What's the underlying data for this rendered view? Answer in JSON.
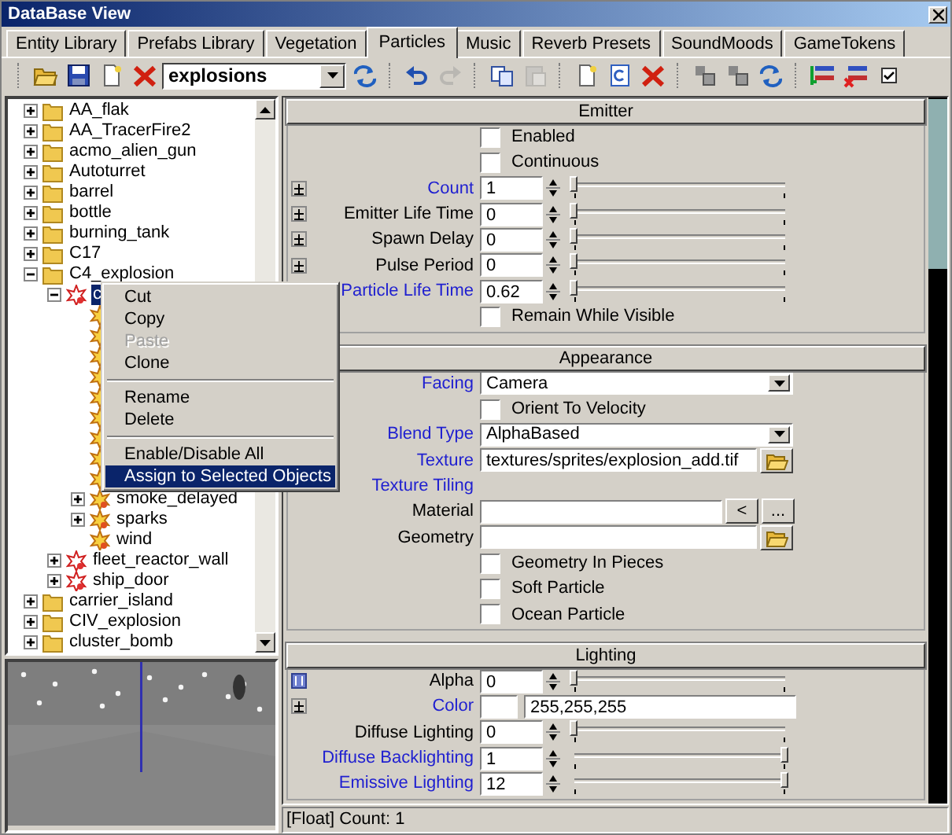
{
  "window": {
    "title": "DataBase View"
  },
  "tabs": [
    {
      "label": "Entity Library",
      "selected": false
    },
    {
      "label": "Prefabs Library",
      "selected": false
    },
    {
      "label": "Vegetation",
      "selected": false
    },
    {
      "label": "Particles",
      "selected": true
    },
    {
      "label": "Music",
      "selected": false
    },
    {
      "label": "Reverb Presets",
      "selected": false
    },
    {
      "label": "SoundMoods",
      "selected": false
    },
    {
      "label": "GameTokens",
      "selected": false
    }
  ],
  "toolbar": {
    "groups": [
      [
        {
          "kind": "open",
          "disabled": false
        },
        {
          "kind": "save",
          "disabled": false
        },
        {
          "kind": "new",
          "disabled": false
        },
        {
          "kind": "delete",
          "disabled": false
        },
        {
          "kind": "combo",
          "value": "explosions"
        },
        {
          "kind": "refresh",
          "disabled": false
        }
      ],
      [
        {
          "kind": "undo",
          "disabled": false
        },
        {
          "kind": "redo",
          "disabled": true
        }
      ],
      [
        {
          "kind": "copy",
          "disabled": false
        },
        {
          "kind": "paste",
          "disabled": true
        }
      ],
      [
        {
          "kind": "new",
          "disabled": false
        },
        {
          "kind": "clone",
          "disabled": false
        },
        {
          "kind": "delete",
          "disabled": false
        }
      ],
      [
        {
          "kind": "pick",
          "disabled": false
        },
        {
          "kind": "pick",
          "disabled": false
        },
        {
          "kind": "refresh",
          "disabled": false
        }
      ],
      [
        {
          "kind": "assign",
          "disabled": false
        },
        {
          "kind": "unassign",
          "disabled": false
        },
        {
          "kind": "check",
          "disabled": false
        }
      ]
    ]
  },
  "tree": [
    {
      "label": "AA_flak",
      "kind": "folder",
      "expandable": true,
      "expanded": false,
      "selected": false
    },
    {
      "label": "AA_TracerFire2",
      "kind": "folder",
      "expandable": true,
      "expanded": false,
      "selected": false
    },
    {
      "label": "acmo_alien_gun",
      "kind": "folder",
      "expandable": true,
      "expanded": false,
      "selected": false
    },
    {
      "label": "Autoturret",
      "kind": "folder",
      "expandable": true,
      "expanded": false,
      "selected": false
    },
    {
      "label": "barrel",
      "kind": "folder",
      "expandable": true,
      "expanded": false,
      "selected": false
    },
    {
      "label": "bottle",
      "kind": "folder",
      "expandable": true,
      "expanded": false,
      "selected": false
    },
    {
      "label": "burning_tank",
      "kind": "folder",
      "expandable": true,
      "expanded": false,
      "selected": false
    },
    {
      "label": "C17",
      "kind": "folder",
      "expandable": true,
      "expanded": false,
      "selected": false
    },
    {
      "label": "C4_explosion",
      "kind": "folder",
      "expandable": true,
      "expanded": true,
      "selected": false,
      "children": [
        {
          "label": "c",
          "kind": "group",
          "expandable": true,
          "expanded": true,
          "selected": true,
          "children": [
            {
              "kind": "effect"
            },
            {
              "kind": "effect"
            },
            {
              "kind": "effect"
            },
            {
              "kind": "effect"
            },
            {
              "kind": "effect"
            },
            {
              "kind": "effect"
            },
            {
              "kind": "effect"
            },
            {
              "kind": "effect"
            },
            {
              "kind": "effect"
            },
            {
              "label": "smoke_delayed",
              "kind": "effect",
              "expandable": true,
              "expanded": false,
              "selected": false
            },
            {
              "label": "sparks",
              "kind": "effect",
              "expandable": true,
              "expanded": false,
              "selected": false
            },
            {
              "label": "wind",
              "kind": "effect",
              "expandable": false,
              "selected": false
            }
          ]
        },
        {
          "label": "fleet_reactor_wall",
          "kind": "group",
          "expandable": true,
          "expanded": false,
          "selected": false
        },
        {
          "label": "ship_door",
          "kind": "group",
          "expandable": true,
          "expanded": false,
          "selected": false
        }
      ]
    },
    {
      "label": "carrier_island",
      "kind": "folder",
      "expandable": true,
      "expanded": false,
      "selected": false
    },
    {
      "label": "CIV_explosion",
      "kind": "folder",
      "expandable": true,
      "expanded": false,
      "selected": false
    },
    {
      "label": "cluster_bomb",
      "kind": "folder",
      "expandable": true,
      "expanded": false,
      "selected": false
    }
  ],
  "context_menu": [
    {
      "kind": "item",
      "label": "Cut",
      "disabled": false,
      "selected": false
    },
    {
      "kind": "item",
      "label": "Copy",
      "disabled": false,
      "selected": false
    },
    {
      "kind": "item",
      "label": "Paste",
      "disabled": true,
      "selected": false
    },
    {
      "kind": "item",
      "label": "Clone",
      "disabled": false,
      "selected": false
    },
    {
      "kind": "separator"
    },
    {
      "kind": "item",
      "label": "Rename",
      "disabled": false,
      "selected": false
    },
    {
      "kind": "item",
      "label": "Delete",
      "disabled": false,
      "selected": false
    },
    {
      "kind": "separator"
    },
    {
      "kind": "item",
      "label": "Enable/Disable All",
      "disabled": false,
      "selected": false
    },
    {
      "kind": "item",
      "label": "Assign to Selected Objects",
      "disabled": false,
      "selected": true
    }
  ],
  "sections": [
    {
      "title": "Emitter",
      "rows": [
        {
          "kind": "checkbox",
          "label": "Enabled",
          "checked": false
        },
        {
          "kind": "checkbox",
          "label": "Continuous",
          "checked": false
        },
        {
          "kind": "spin",
          "label": "Count",
          "value": "1",
          "level": 0,
          "highlighted": true,
          "expand_button": true,
          "pinned": false
        },
        {
          "kind": "spin",
          "label": "Emitter Life Time",
          "value": "0",
          "level": 0,
          "highlighted": false,
          "expand_button": true,
          "pinned": false
        },
        {
          "kind": "spin",
          "label": "Spawn Delay",
          "value": "0",
          "level": 0,
          "highlighted": false,
          "expand_button": true,
          "pinned": false
        },
        {
          "kind": "spin",
          "label": "Pulse Period",
          "value": "0",
          "level": 0,
          "highlighted": false,
          "expand_button": true,
          "pinned": false
        },
        {
          "kind": "spin",
          "label": "Particle Life Time",
          "value": "0.62",
          "level": 0,
          "highlighted": true
        },
        {
          "kind": "checkbox",
          "label": "Remain While Visible",
          "checked": false
        }
      ]
    },
    {
      "title": "Appearance",
      "rows": [
        {
          "kind": "dropdown",
          "label": "Facing",
          "value": "Camera",
          "highlighted": true
        },
        {
          "kind": "checkbox",
          "label": "Orient To Velocity",
          "checked": false
        },
        {
          "kind": "dropdown",
          "label": "Blend Type",
          "value": "AlphaBased",
          "highlighted": true
        },
        {
          "kind": "file",
          "label": "Texture",
          "value": "textures/sprites/explosion_add.tif",
          "highlighted": true
        },
        {
          "kind": "heading",
          "label": "Texture Tiling",
          "highlighted": true
        },
        {
          "kind": "material",
          "label": "Material",
          "highlighted": false,
          "pick": "<",
          "browse": "..."
        },
        {
          "kind": "file",
          "label": "Geometry",
          "highlighted": false
        },
        {
          "kind": "checkbox",
          "label": "Geometry In Pieces",
          "checked": false
        },
        {
          "kind": "checkbox",
          "label": "Soft Particle",
          "checked": false
        },
        {
          "kind": "checkbox",
          "label": "Ocean Particle",
          "checked": false
        }
      ]
    },
    {
      "title": "Lighting",
      "rows": [
        {
          "kind": "spin",
          "label": "Alpha",
          "value": "0",
          "level": 0,
          "highlighted": false,
          "expand_button": true,
          "pinned": true
        },
        {
          "kind": "color",
          "label": "Color",
          "value": "255,255,255",
          "color": "#ffffff",
          "highlighted": true,
          "expand_button": true,
          "pinned": false
        },
        {
          "kind": "spin",
          "label": "Diffuse Lighting",
          "value": "0",
          "level": 0,
          "highlighted": false
        },
        {
          "kind": "spin",
          "label": "Diffuse Backlighting",
          "value": "1",
          "level": 1,
          "highlighted": true
        },
        {
          "kind": "spin",
          "label": "Emissive Lighting",
          "value": "12",
          "level": 1,
          "highlighted": true
        }
      ]
    }
  ],
  "status_bar": "[Float] Count: 1"
}
